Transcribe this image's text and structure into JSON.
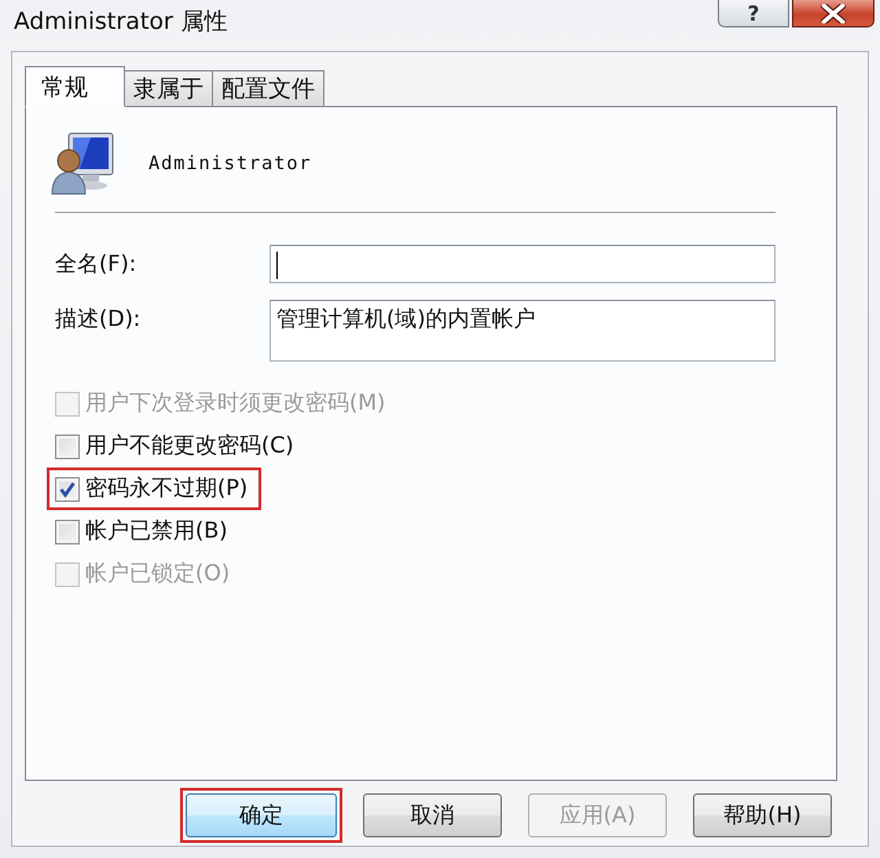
{
  "window": {
    "title": "Administrator 属性",
    "help_button": "?"
  },
  "tabs": [
    {
      "label": "常规",
      "selected": true
    },
    {
      "label": "隶属于",
      "selected": false
    },
    {
      "label": "配置文件",
      "selected": false
    }
  ],
  "account": {
    "name": "Administrator"
  },
  "fields": [
    {
      "label": "全名(F):",
      "kind": "line",
      "caret": true
    },
    {
      "label": "描述(D):",
      "kind": "box",
      "value": "管理计算机(域)的内置帐户",
      "caret": false
    }
  ],
  "options": [
    {
      "label": "用户下次登录时须更改密码(M)",
      "checked": false,
      "disabled": true,
      "highlighted": false
    },
    {
      "label": "用户不能更改密码(C)",
      "checked": false,
      "disabled": false,
      "highlighted": false
    },
    {
      "label": "密码永不过期(P)",
      "checked": true,
      "disabled": false,
      "highlighted": true
    },
    {
      "label": "帐户已禁用(B)",
      "checked": false,
      "disabled": false,
      "highlighted": false
    },
    {
      "label": "帐户已锁定(O)",
      "checked": false,
      "disabled": true,
      "highlighted": false
    }
  ],
  "buttons": [
    {
      "label": "确定",
      "disabled": false,
      "default": true,
      "highlighted": true
    },
    {
      "label": "取消",
      "disabled": false,
      "default": false,
      "highlighted": false
    },
    {
      "label": "应用(A)",
      "disabled": true,
      "default": false,
      "highlighted": false
    },
    {
      "label": "帮助(H)",
      "disabled": false,
      "default": false,
      "highlighted": false
    }
  ]
}
